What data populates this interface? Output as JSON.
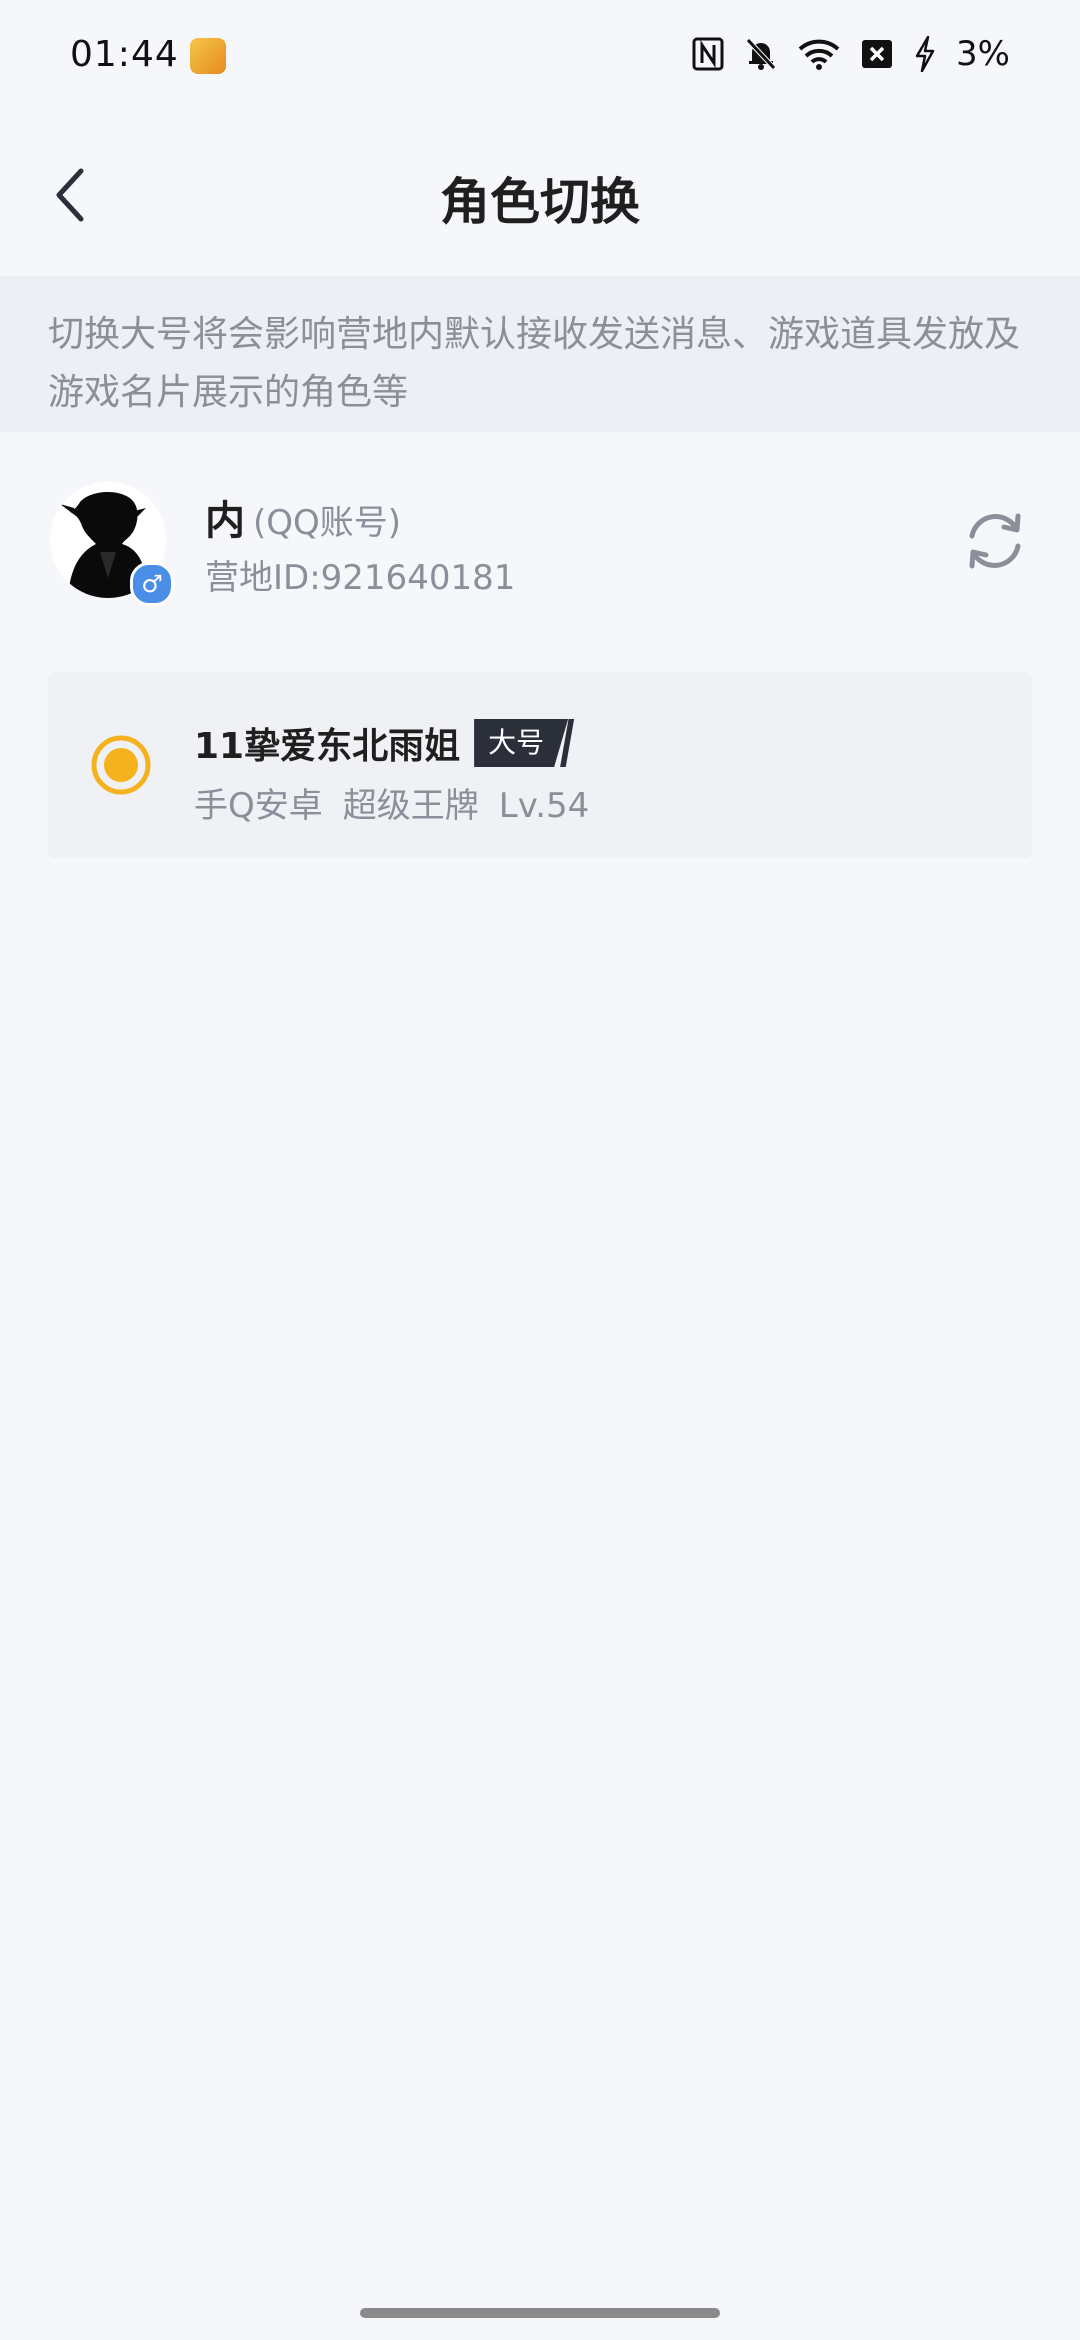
{
  "status_bar": {
    "time": "01:44",
    "battery": "3%",
    "icons": [
      "app-icon",
      "nfc-icon",
      "bell-off-icon",
      "wifi-icon",
      "sim-error-icon",
      "charging-icon"
    ]
  },
  "header": {
    "title": "角色切换",
    "back_icon": "chevron-left-icon"
  },
  "notice": {
    "text": "切换大号将会影响营地内默认接收发送消息、游戏道具发放及游戏名片展示的角色等"
  },
  "account": {
    "name": "内",
    "type": "(QQ账号)",
    "id_text": "营地ID:921640181",
    "gender_symbol": "♂",
    "refresh_icon": "refresh-icon"
  },
  "roles": [
    {
      "name": "11挚爱东北雨姐",
      "tag": "大号",
      "platform": "手Q安卓",
      "rank": "超级王牌",
      "level": "Lv.54",
      "selected": true
    }
  ],
  "colors": {
    "background": "#f5f7fa",
    "notice_bg": "#eceff3",
    "card_bg": "#eff1f5",
    "secondary_text": "#8a8f99",
    "radio_accent": "#f5b21f",
    "tag_bg": "#2b2f3a",
    "gender_badge": "#4a8ee8"
  }
}
